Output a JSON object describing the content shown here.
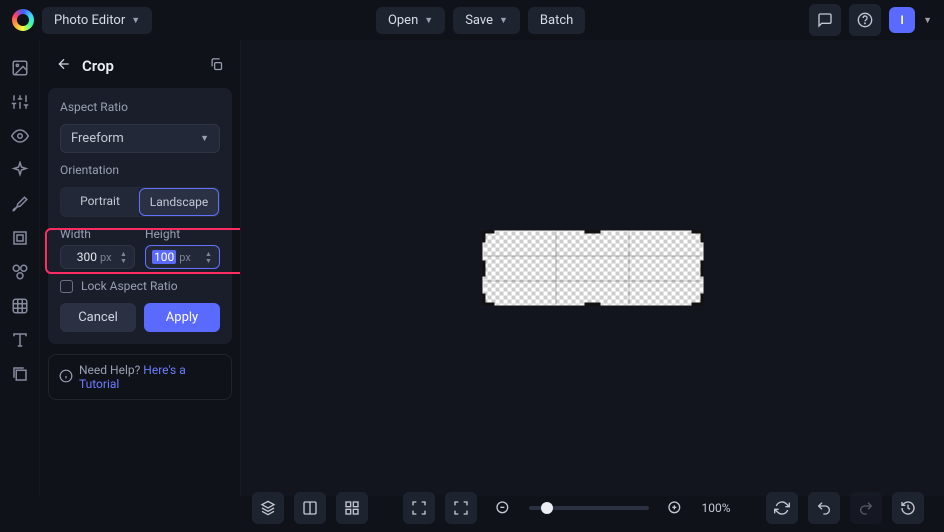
{
  "topbar": {
    "app_dropdown": "Photo Editor",
    "open": "Open",
    "save": "Save",
    "batch": "Batch",
    "avatar_letter": "I"
  },
  "panel": {
    "title": "Crop",
    "aspect_ratio_label": "Aspect Ratio",
    "aspect_ratio_value": "Freeform",
    "orientation_label": "Orientation",
    "portrait": "Portrait",
    "landscape": "Landscape",
    "width_label": "Width",
    "height_label": "Height",
    "width_value": "300",
    "height_value": "100",
    "unit": "px",
    "lock_label": "Lock Aspect Ratio",
    "cancel": "Cancel",
    "apply": "Apply",
    "help_prefix": "Need Help? ",
    "help_link": "Here's a Tutorial"
  },
  "bottom": {
    "zoom_pct": "100%"
  }
}
